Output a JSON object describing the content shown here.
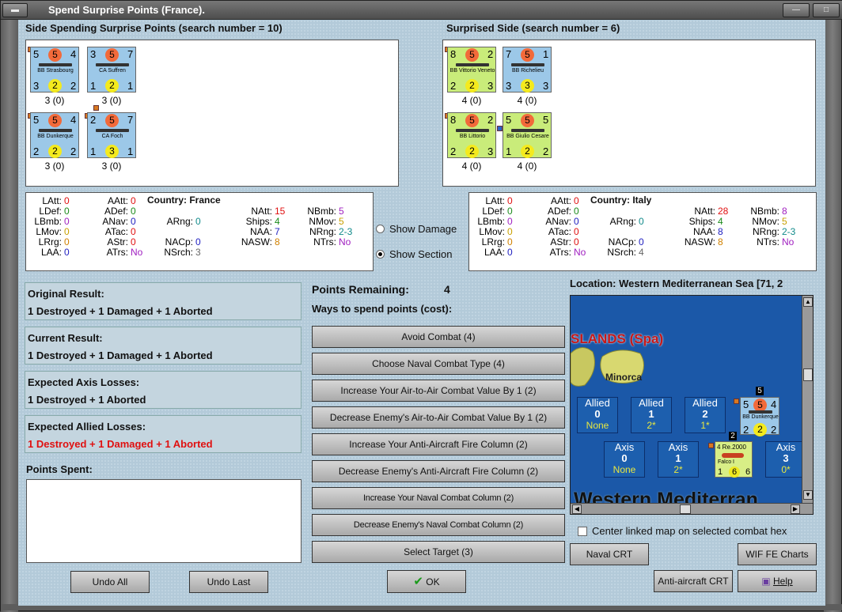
{
  "window": {
    "title": "Spend Surprise Points (France)."
  },
  "left_side": {
    "header": "Side Spending Surprise Points (search number = 10)",
    "counters": [
      {
        "name": "BB Strasbourg",
        "tl": "5",
        "tc": "5",
        "tr": "4",
        "bl": "3",
        "bc": "2",
        "br": "2",
        "sub": "3 (0)"
      },
      {
        "name": "CA Suffren",
        "tl": "3",
        "tc": "5",
        "tr": "7",
        "bl": "1",
        "bc": "2",
        "br": "1",
        "sub": "3 (0)"
      },
      {
        "name": "BB Dunkerque",
        "tl": "5",
        "tc": "5",
        "tr": "4",
        "bl": "2",
        "bc": "2",
        "br": "2",
        "sub": "3 (0)"
      },
      {
        "name": "CA Foch",
        "tl": "2",
        "tc": "5",
        "tr": "7",
        "bl": "1",
        "bc": "3",
        "br": "1",
        "sub": "3 (0)"
      }
    ]
  },
  "right_side": {
    "header": "Surprised Side (search number = 6)",
    "counters": [
      {
        "name": "BB Vittorio Veneto",
        "tl": "8",
        "tc": "5",
        "tr": "2",
        "bl": "2",
        "bc": "2",
        "br": "3",
        "sub": "4 (0)"
      },
      {
        "name": "BB Richelieu",
        "tl": "7",
        "tc": "5",
        "tr": "1",
        "bl": "3",
        "bc": "3",
        "br": "3",
        "sub": "4 (0)"
      },
      {
        "name": "BB Littorio",
        "tl": "8",
        "tc": "5",
        "tr": "2",
        "bl": "2",
        "bc": "2",
        "br": "3",
        "sub": "4 (0)"
      },
      {
        "name": "BB Giulio Cesare",
        "tl": "5",
        "tc": "5",
        "tr": "5",
        "bl": "1",
        "bc": "2",
        "br": "2",
        "sub": "4 (0)"
      }
    ]
  },
  "stats_left": {
    "country_label": "Country: France",
    "items": [
      [
        "LAtt:",
        "0"
      ],
      [
        "LDef:",
        "0"
      ],
      [
        "LBmb:",
        "0"
      ],
      [
        "LMov:",
        "0"
      ],
      [
        "LRrg:",
        "0"
      ],
      [
        "LAA:",
        "0"
      ],
      [
        "AAtt:",
        "0"
      ],
      [
        "ADef:",
        "0"
      ],
      [
        "ANav:",
        "0"
      ],
      [
        "ATac:",
        "0"
      ],
      [
        "AStr:",
        "0"
      ],
      [
        "ATrs:",
        "No"
      ],
      [
        "ARng:",
        "0"
      ],
      [
        "NACp:",
        "0"
      ],
      [
        "NSrch:",
        "3"
      ],
      [
        "NAtt:",
        "15"
      ],
      [
        "Ships:",
        "4"
      ],
      [
        "NAA:",
        "7"
      ],
      [
        "NASW:",
        "8"
      ],
      [
        "NBmb:",
        "5"
      ],
      [
        "NMov:",
        "5"
      ],
      [
        "NRng:",
        "2-3"
      ],
      [
        "NTrs:",
        "No"
      ]
    ]
  },
  "stats_right": {
    "country_label": "Country: Italy",
    "items": [
      [
        "LAtt:",
        "0"
      ],
      [
        "LDef:",
        "0"
      ],
      [
        "LBmb:",
        "0"
      ],
      [
        "LMov:",
        "0"
      ],
      [
        "LRrg:",
        "0"
      ],
      [
        "LAA:",
        "0"
      ],
      [
        "AAtt:",
        "0"
      ],
      [
        "ADef:",
        "0"
      ],
      [
        "ANav:",
        "0"
      ],
      [
        "ATac:",
        "0"
      ],
      [
        "AStr:",
        "0"
      ],
      [
        "ATrs:",
        "No"
      ],
      [
        "ARng:",
        "0"
      ],
      [
        "NACp:",
        "0"
      ],
      [
        "NSrch:",
        "4"
      ],
      [
        "NAtt:",
        "28"
      ],
      [
        "Ships:",
        "4"
      ],
      [
        "NAA:",
        "8"
      ],
      [
        "NASW:",
        "8"
      ],
      [
        "NBmb:",
        "8"
      ],
      [
        "NMov:",
        "5"
      ],
      [
        "NRng:",
        "2-3"
      ],
      [
        "NTrs:",
        "No"
      ]
    ]
  },
  "options": {
    "show_damage": "Show Damage",
    "show_section": "Show Section"
  },
  "results": [
    {
      "label": "Original Result:",
      "value": "1 Destroyed + 1 Damaged + 1 Aborted"
    },
    {
      "label": "Current Result:",
      "value": "1 Destroyed + 1 Damaged + 1 Aborted"
    },
    {
      "label": "Expected Axis Losses:",
      "value": "1 Destroyed + 1 Aborted"
    },
    {
      "label": "Expected Allied Losses:",
      "value": "1 Destroyed + 1 Damaged + 1 Aborted"
    }
  ],
  "points_spent_label": "Points Spent:",
  "points_remaining_label": "Points Remaining:",
  "points_remaining_value": "4",
  "ways_label": "Ways to spend points (cost):",
  "spend_buttons": [
    "Avoid Combat (4)",
    "Choose Naval Combat Type (4)",
    "Increase Your Air-to-Air Combat Value By 1 (2)",
    "Decrease Enemy's Air-to-Air Combat Value By 1 (2)",
    "Increase Your Anti-Aircraft Fire Column (2)",
    "Decrease Enemy's Anti-Aircraft Fire Column (2)",
    "Increase Your Naval Combat Column (2)",
    "Decrease Enemy's Naval Combat Column (2)",
    "Select Target (3)"
  ],
  "location_label": "Location: Western Mediterranean Sea [71, 2",
  "map": {
    "islands_label": "SLANDS (Spa)",
    "minorca_label": "Minorca",
    "sea_label": "Western Mediterran",
    "allied": [
      {
        "side": "Allied",
        "num": "0",
        "sub": "None"
      },
      {
        "side": "Allied",
        "num": "1",
        "sub": "2*"
      },
      {
        "side": "Allied",
        "num": "2",
        "sub": "1*"
      }
    ],
    "axis": [
      {
        "side": "Axis",
        "num": "0",
        "sub": "None"
      },
      {
        "side": "Axis",
        "num": "1",
        "sub": "2*"
      },
      {
        "side": "Axis",
        "num": "3",
        "sub": "0*"
      }
    ],
    "stack_count_1": "5",
    "stack_count_2": "2",
    "unit_dunkerque": {
      "name": "BB Dunkerque",
      "tl": "5",
      "tc": "5",
      "tr": "4",
      "bl": "2",
      "bc": "2",
      "br": "2"
    },
    "unit_falco": {
      "name": "Falco I",
      "top": "4 Re.2000",
      "bl": "1",
      "bc": "6",
      "br": "6"
    }
  },
  "center_linked_label": "Center linked map on selected combat hex",
  "buttons": {
    "naval_crt": "Naval CRT",
    "wif_charts": "WIF FE Charts",
    "aa_crt": "Anti-aircraft CRT",
    "help": "Help",
    "undo_all": "Undo All",
    "undo_last": "Undo Last",
    "ok": "OK"
  }
}
